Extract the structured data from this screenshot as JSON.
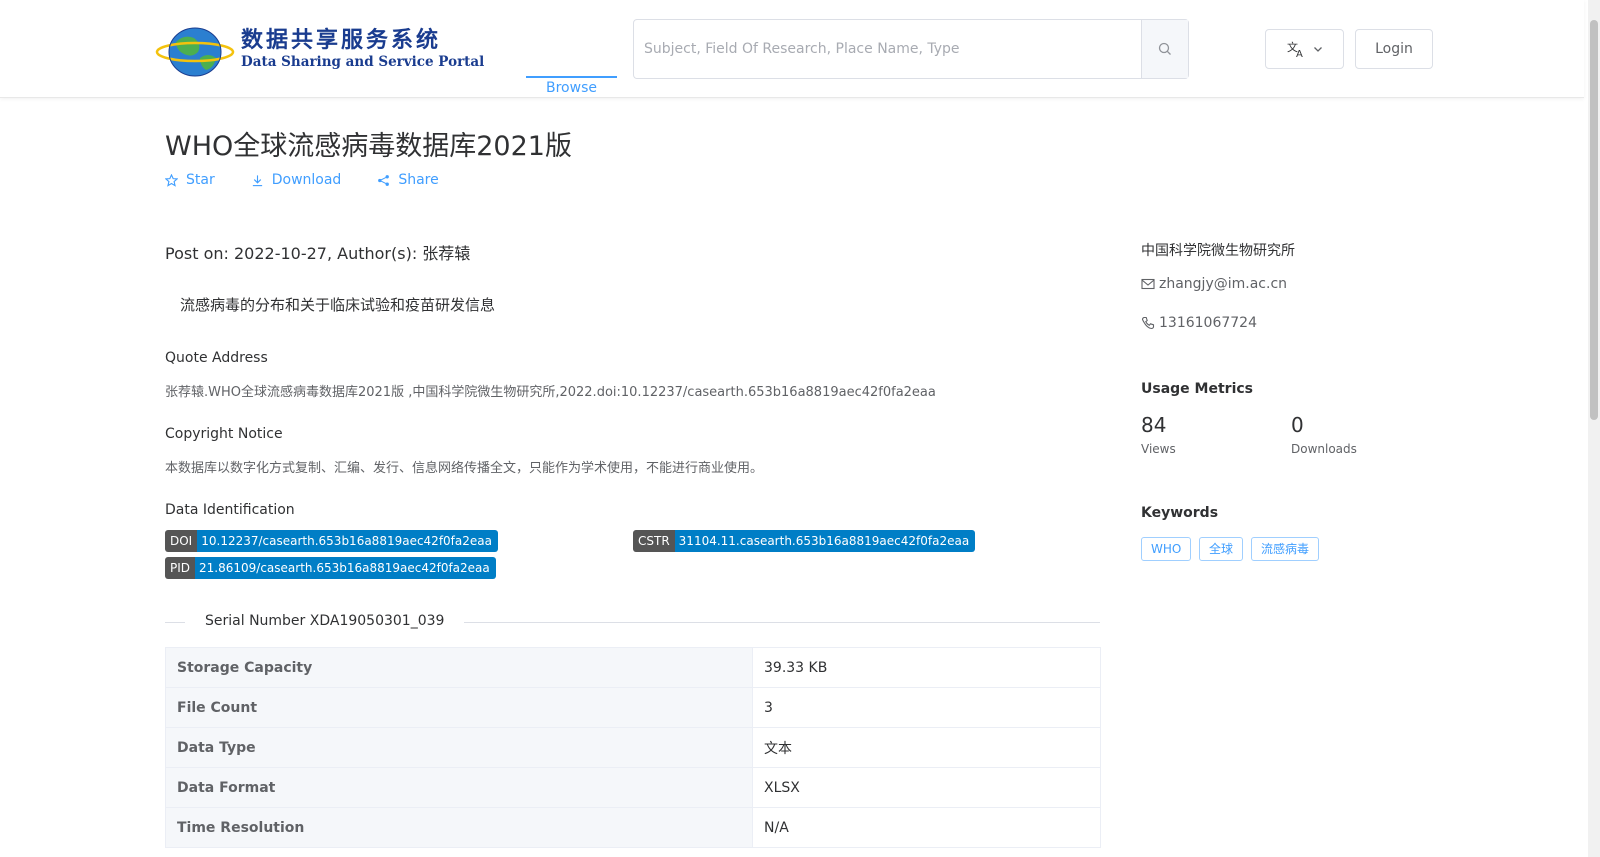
{
  "header": {
    "logo_cn": "数据共享服务系统",
    "logo_en": "Data Sharing and Service Portal",
    "nav_browse": "Browse",
    "search_placeholder": "Subject, Field Of Research, Place Name, Type",
    "login_label": "Login"
  },
  "dataset": {
    "title": "WHO全球流感病毒数据库2021版",
    "actions": {
      "star": "Star",
      "download": "Download",
      "share": "Share"
    },
    "post_on": "Post on: 2022-10-27, Author(s): 张荐辕",
    "description": "流感病毒的分布和关于临床试验和疫苗研发信息",
    "quote_label": "Quote Address",
    "quote_text": "张荐辕.WHO全球流感病毒数据库2021版 ,中国科学院微生物研究所,2022.doi:10.12237/casearth.653b16a8819aec42f0fa2eaa",
    "copyright_label": "Copyright Notice",
    "copyright_text": "本数据库以数字化方式复制、汇编、发行、信息网络传播全文，只能作为学术使用，不能进行商业使用。",
    "identification_label": "Data Identification",
    "identifiers": {
      "doi_key": "DOI",
      "doi_value": "10.12237/casearth.653b16a8819aec42f0fa2eaa",
      "cstr_key": "CSTR",
      "cstr_value": "31104.11.casearth.653b16a8819aec42f0fa2eaa",
      "pid_key": "PID",
      "pid_value": "21.86109/casearth.653b16a8819aec42f0fa2eaa"
    },
    "serial_number": "Serial Number XDA19050301_039",
    "table": [
      {
        "key": "Storage Capacity",
        "value": "39.33 KB"
      },
      {
        "key": "File Count",
        "value": "3"
      },
      {
        "key": "Data Type",
        "value": "文本"
      },
      {
        "key": "Data Format",
        "value": "XLSX"
      },
      {
        "key": "Time Resolution",
        "value": "N/A"
      }
    ]
  },
  "sidebar": {
    "organization": "中国科学院微生物研究所",
    "email": "zhangjy@im.ac.cn",
    "phone": "13161067724",
    "usage_title": "Usage Metrics",
    "views_value": "84",
    "views_label": "Views",
    "downloads_value": "0",
    "downloads_label": "Downloads",
    "keywords_title": "Keywords",
    "keywords": [
      "WHO",
      "全球",
      "流感病毒"
    ]
  },
  "colors": {
    "accent": "#409eff",
    "tag_key": "#555555",
    "tag_value": "#007ec6",
    "logo": "#1a3c8f"
  }
}
